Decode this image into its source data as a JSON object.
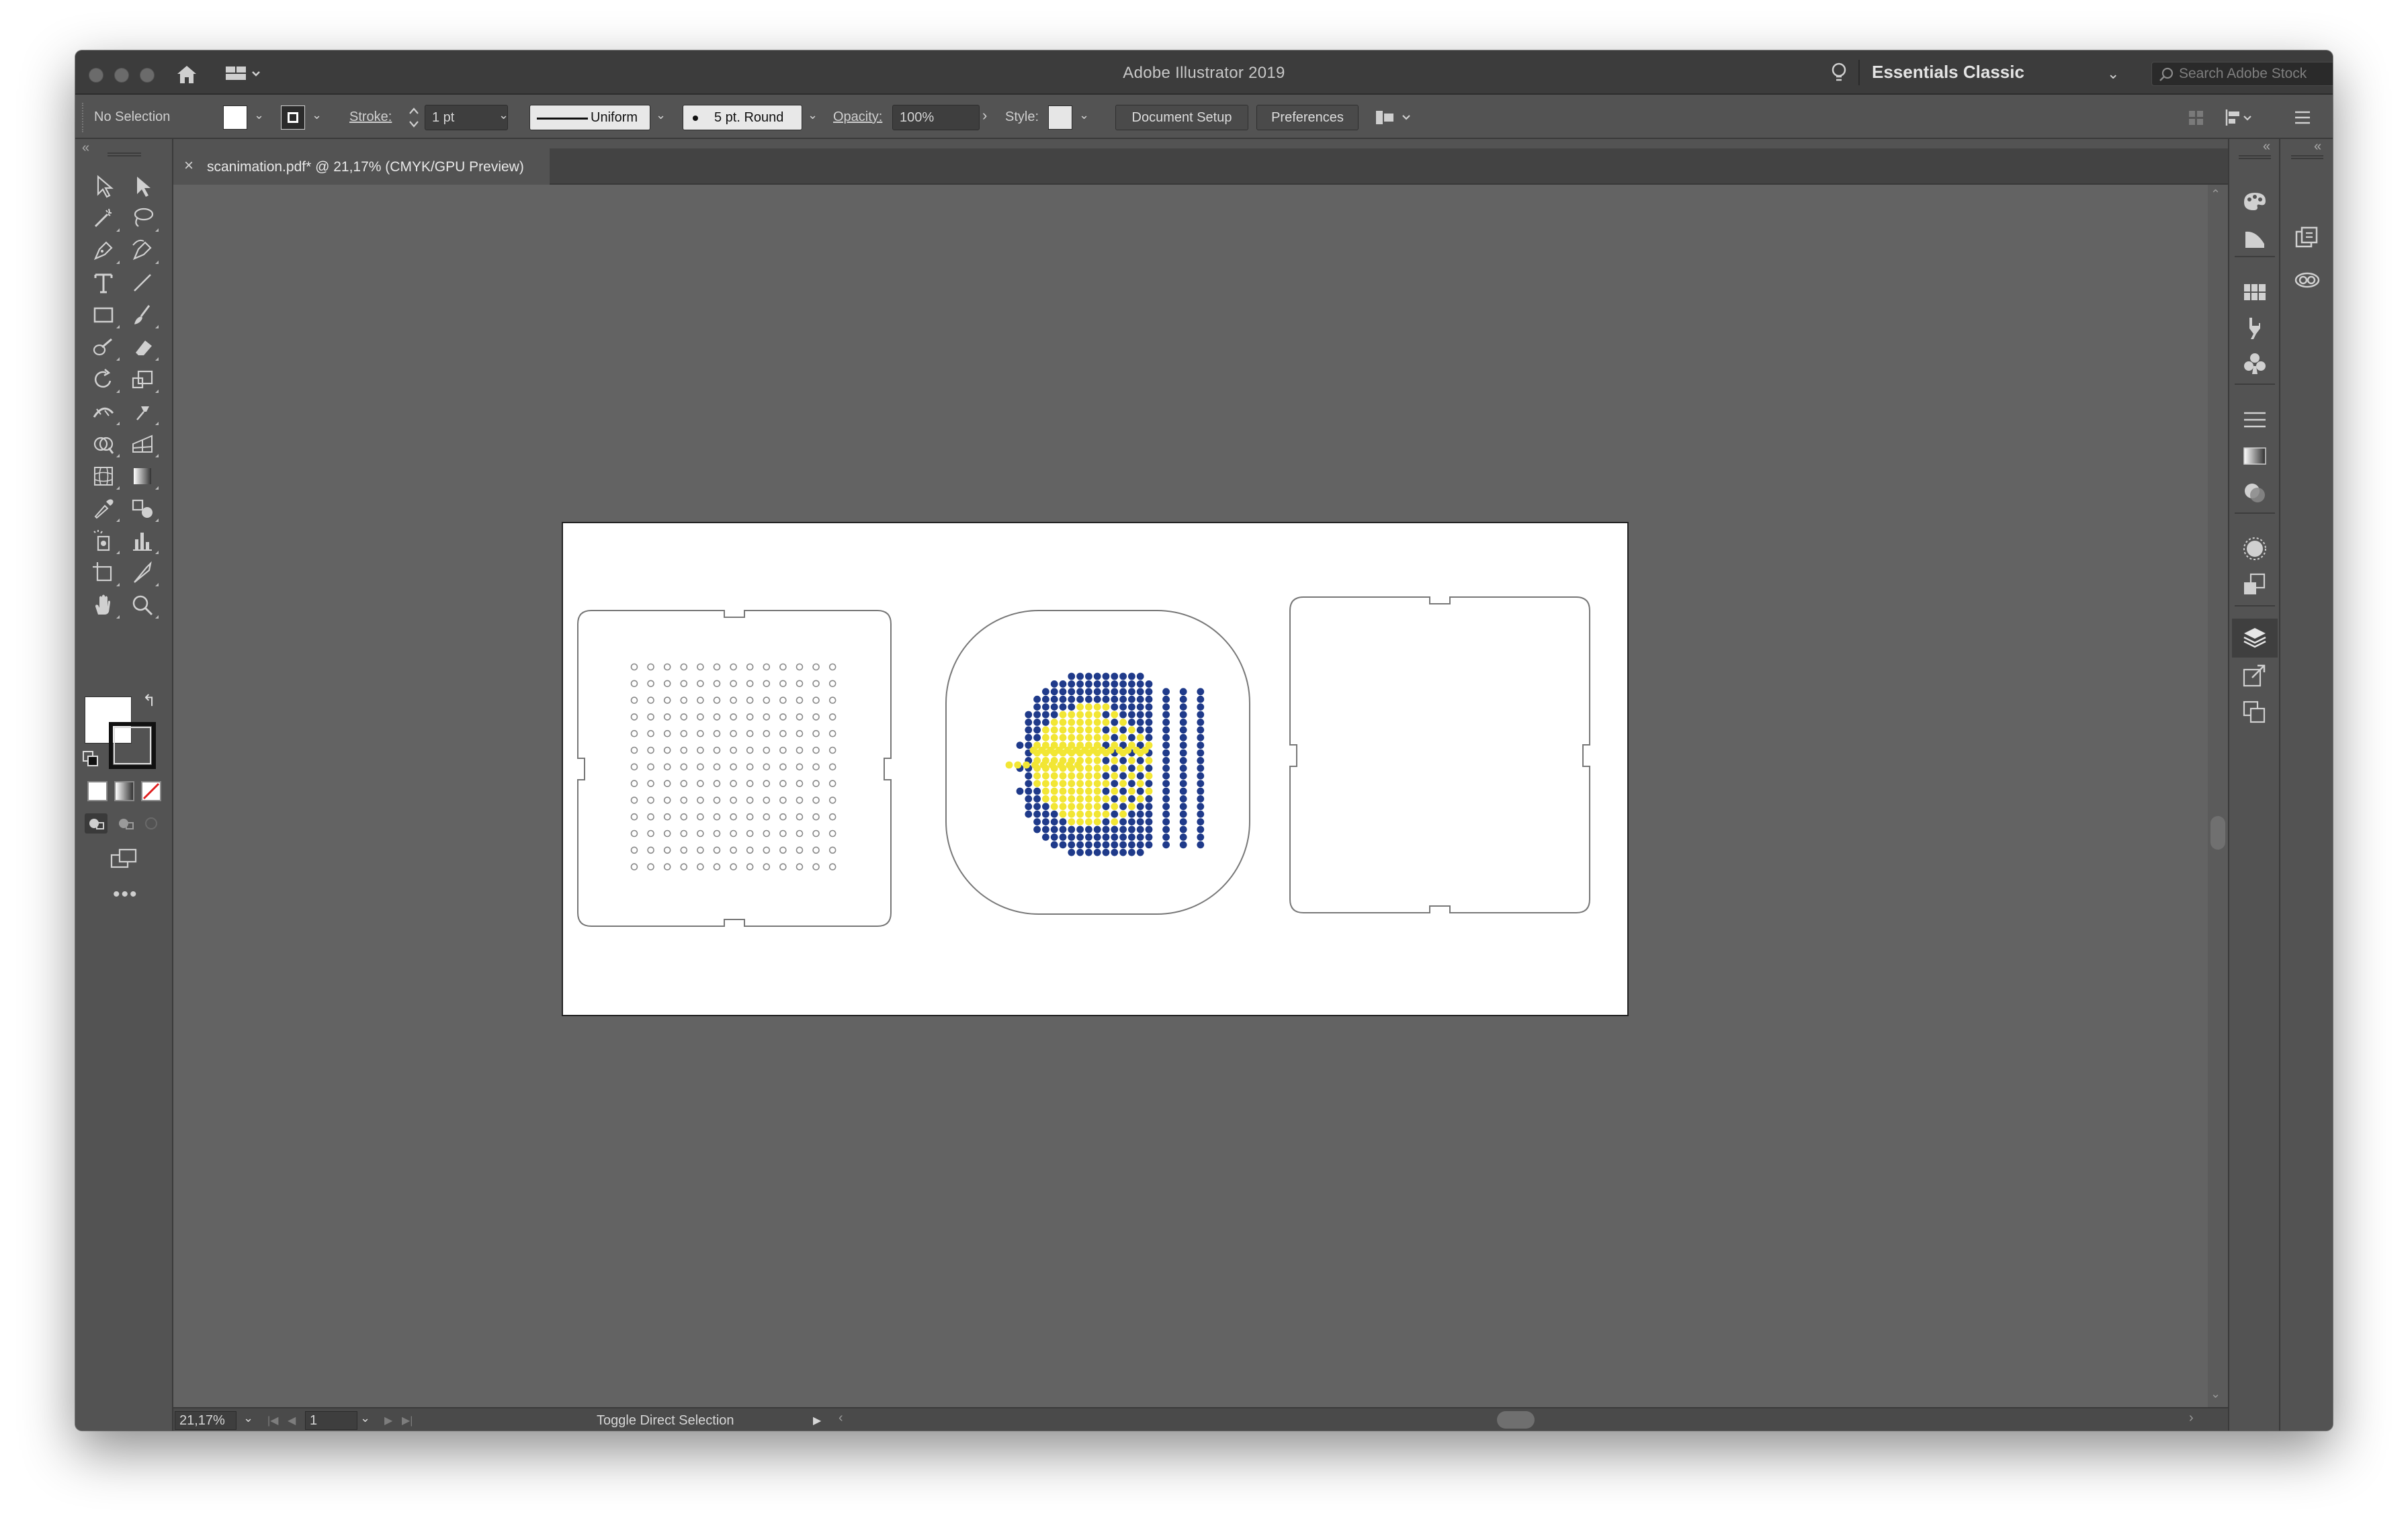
{
  "window": {
    "title": "Adobe Illustrator 2019",
    "workspace": "Essentials Classic",
    "search_placeholder": "Search Adobe Stock"
  },
  "control_bar": {
    "selection": "No Selection",
    "stroke_label": "Stroke:",
    "stroke_weight": "1 pt",
    "profile": "Uniform",
    "brush": "5 pt. Round",
    "opacity_label": "Opacity:",
    "opacity_value": "100%",
    "style_label": "Style:",
    "document_setup": "Document Setup",
    "preferences": "Preferences"
  },
  "document": {
    "tab_title": "scanimation.pdf* @ 21,17% (CMYK/GPU Preview)"
  },
  "status_bar": {
    "zoom": "21,17%",
    "artboard_number": "1",
    "status_text": "Toggle Direct Selection"
  },
  "artwork": {
    "dot_colors": {
      "blue": "#1f3a8a",
      "yellow": "#f2e634"
    },
    "grid_rows": 13,
    "grid_cols": 13
  }
}
